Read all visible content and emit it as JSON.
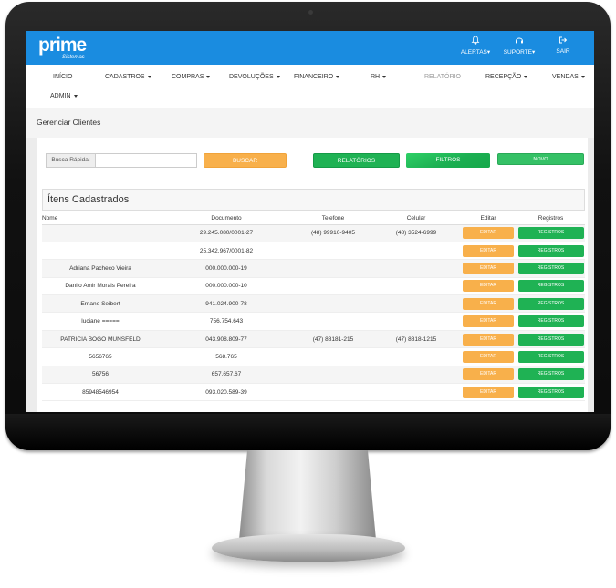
{
  "brand": {
    "name": "prime",
    "tagline": "Sistemas"
  },
  "top_actions": [
    {
      "label": "ALERTAS",
      "icon": "bell-icon"
    },
    {
      "label": "SUPORTE",
      "icon": "headset-icon"
    },
    {
      "label": "SAIR",
      "icon": "logout-icon"
    }
  ],
  "menu": {
    "inicio": "INÍCIO",
    "cadastros": "CADASTROS",
    "compras": "COMPRAS",
    "devolucoes": "DEVOLUÇÕES",
    "financeiro": "FINANCEIRO",
    "rh": "RH",
    "relatorio": "RELATÓRIO",
    "recepcao": "RECEPÇÃO",
    "vendas": "VENDAS",
    "admin": "ADMIN"
  },
  "page_title": "Gerenciar Clientes",
  "search": {
    "label": "Busca Rápida:",
    "value": "",
    "placeholder": ""
  },
  "buttons": {
    "buscar": "BUSCAR",
    "relatorios": "RELATÓRIOS",
    "filtros": "FILTROS",
    "novo": "NOVO"
  },
  "section_title": "Ítens Cadastrados",
  "columns": [
    "Nome",
    "Documento",
    "Telefone",
    "Celular",
    "Editar",
    "Registros"
  ],
  "row_actions": {
    "edit": "EDITAR",
    "registros": "REGISTROS"
  },
  "rows": [
    {
      "nome": "",
      "documento": "29.245.080/0001-27",
      "telefone": "(48) 99910-9405",
      "celular": "(48) 3524-6999"
    },
    {
      "nome": "",
      "documento": "25.342.967/0001-82",
      "telefone": "",
      "celular": ""
    },
    {
      "nome": "Adriana Pacheco Vieira",
      "documento": "000.000.000-19",
      "telefone": "",
      "celular": ""
    },
    {
      "nome": "Danilo Amir Morais Pereira",
      "documento": "000.000.000-10",
      "telefone": "",
      "celular": ""
    },
    {
      "nome": "Ernane Seibert",
      "documento": "941.024.900-78",
      "telefone": "",
      "celular": ""
    },
    {
      "nome": "luciane =====",
      "documento": "756.754.643",
      "telefone": "",
      "celular": ""
    },
    {
      "nome": "PATRICIA BOGO MUNSFELD",
      "documento": "043.908.809-77",
      "telefone": "(47) 88181-215",
      "celular": "(47) 8818-1215"
    },
    {
      "nome": "5656765",
      "documento": "568.765",
      "telefone": "",
      "celular": ""
    },
    {
      "nome": "56756",
      "documento": "657.657.67",
      "telefone": "",
      "celular": ""
    },
    {
      "nome": "85948546954",
      "documento": "093.020.589-39",
      "telefone": "",
      "celular": ""
    }
  ]
}
